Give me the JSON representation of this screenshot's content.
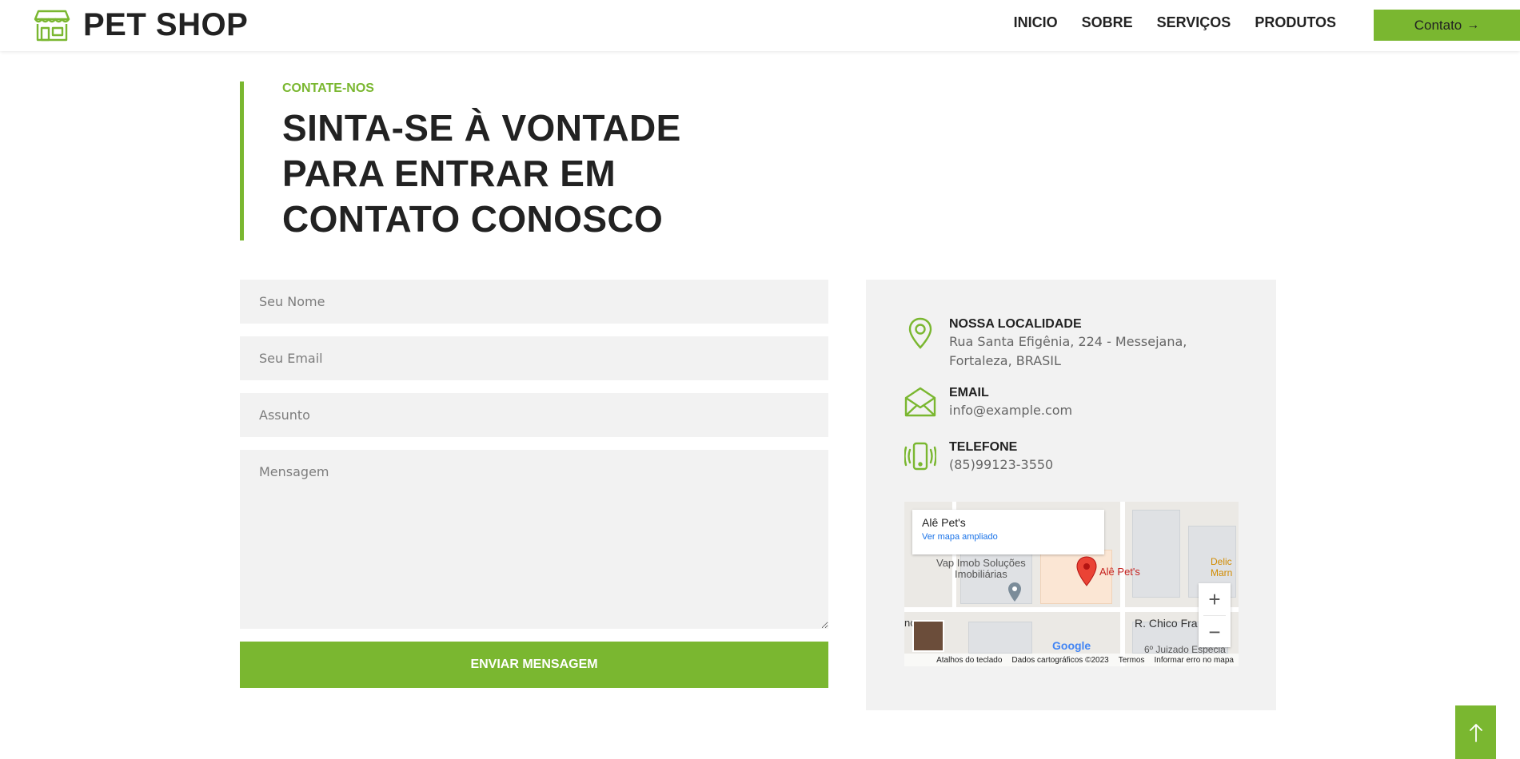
{
  "brand": {
    "name": "PET SHOP",
    "icon": "storefront-icon"
  },
  "nav": {
    "links": [
      "INICIO",
      "SOBRE",
      "SERVIÇOS",
      "PRODUTOS"
    ],
    "cta_label": "Contato",
    "cta_arrow": "→"
  },
  "header": {
    "eyebrow": "CONTATE-NOS",
    "title_lines": [
      "SINTA-SE À VONTADE",
      "PARA ENTRAR EM",
      "CONTATO CONOSCO"
    ]
  },
  "form": {
    "name_placeholder": "Seu Nome",
    "email_placeholder": "Seu Email",
    "subject_placeholder": "Assunto",
    "message_placeholder": "Mensagem",
    "submit_label": "ENVIAR MENSAGEM"
  },
  "contact": {
    "location_title": "NOSSA LOCALIDADE",
    "location_line1": "Rua Santa Efigênia, 224 - Messejana,",
    "location_line2": "Fortaleza, BRASIL",
    "email_title": "EMAIL",
    "email_value": "info@example.com",
    "phone_title": "TELEFONE",
    "phone_value": "(85)99123-3550"
  },
  "map": {
    "place_name": "Alê Pet's",
    "view_larger": "Ver mapa ampliado",
    "pin_label": "Alê Pet's",
    "label_vap_1": "Vap Imob Soluções",
    "label_vap_2": "Imobiliárias",
    "label_street": "R. Chico Fra",
    "label_left": "nca",
    "label_juizado": "6º Juizado Especia",
    "label_delic": "Delic",
    "label_marn": "Marn",
    "google": "Google",
    "footer": [
      "Atalhos do teclado",
      "Dados cartográficos ©2023",
      "Termos",
      "Informar erro no mapa"
    ],
    "zoom_in": "+",
    "zoom_out": "−"
  },
  "colors": {
    "accent": "#7ab730",
    "panel": "#f2f2f2",
    "text": "#222222"
  },
  "back_to_top": "↑"
}
